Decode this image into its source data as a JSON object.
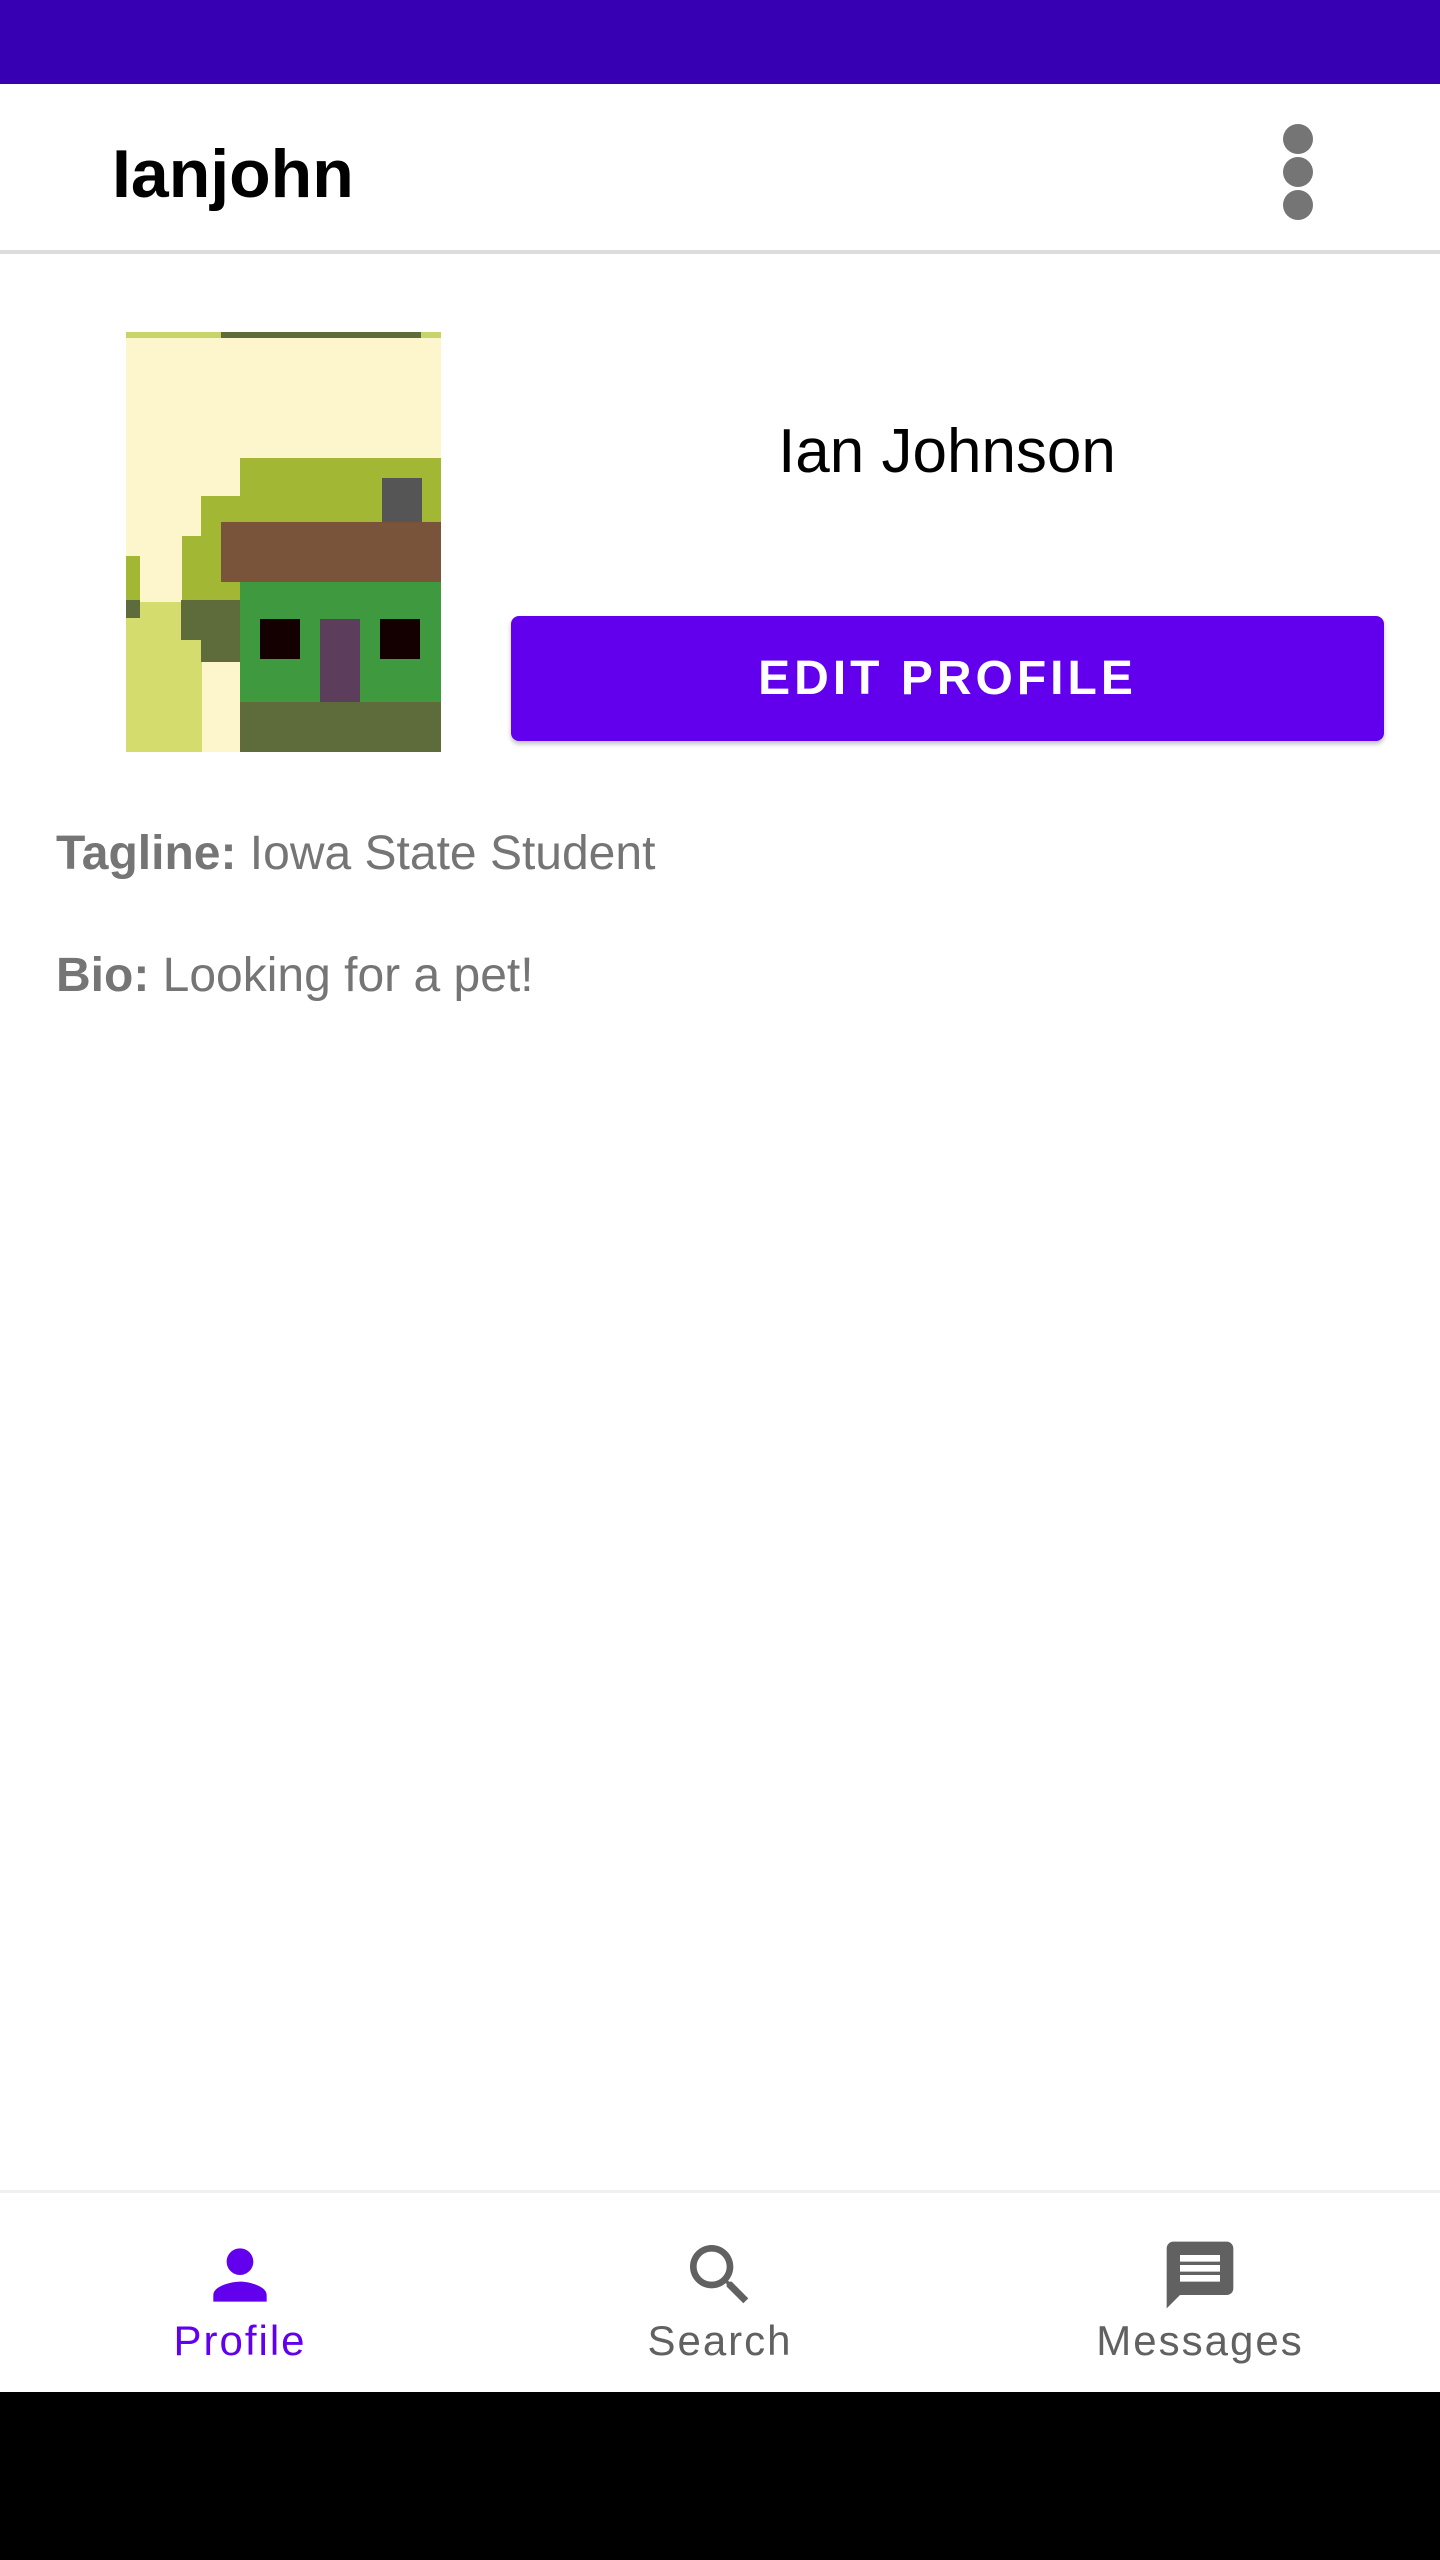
{
  "app_bar": {
    "title": "Ianjohn",
    "menu_icon": "more-vert-icon"
  },
  "profile": {
    "display_name": "Ian Johnson",
    "edit_button_label": "EDIT PROFILE",
    "tagline_label": "Tagline:",
    "tagline_value": "Iowa State Student",
    "bio_label": "Bio:",
    "bio_value": "Looking for a pet!"
  },
  "bottom_nav": {
    "items": [
      {
        "label": "Profile",
        "icon": "person-icon",
        "active": true
      },
      {
        "label": "Search",
        "icon": "search-icon",
        "active": false
      },
      {
        "label": "Messages",
        "icon": "message-icon",
        "active": false
      }
    ]
  },
  "colors": {
    "status_bar": "#3700b3",
    "primary": "#6200ee",
    "inactive": "#616161",
    "text_secondary": "#757575"
  }
}
